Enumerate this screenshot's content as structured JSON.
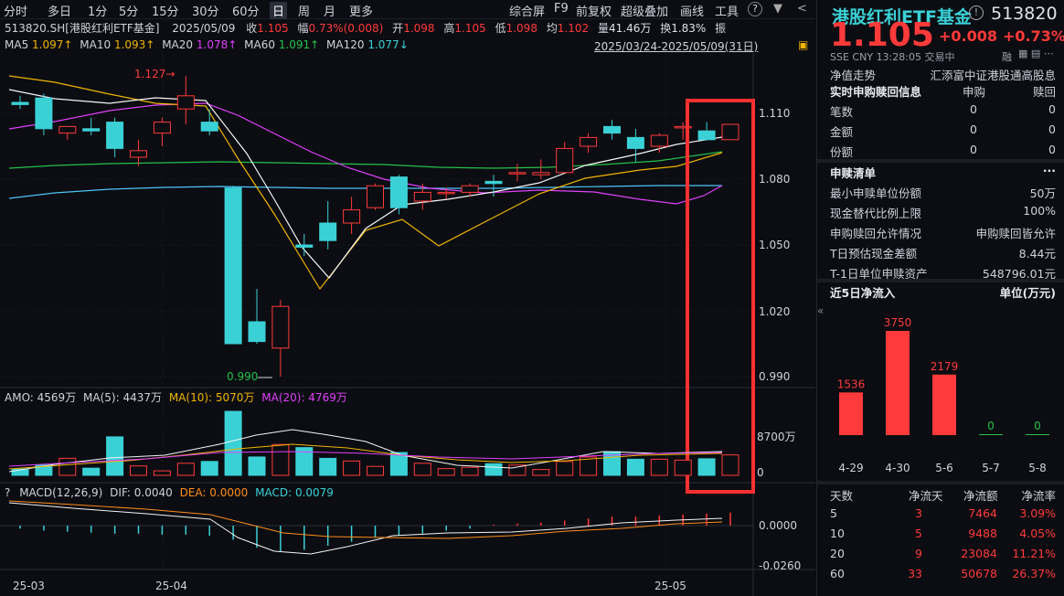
{
  "toolbar": {
    "left_items": [
      "分时",
      "多日",
      "1分",
      "5分",
      "15分",
      "30分",
      "60分",
      "日",
      "周",
      "月",
      "更多"
    ],
    "active": "日",
    "right_items": [
      "综合屏",
      "F9",
      "前复权",
      "超级叠加",
      "画线",
      "工具",
      "?"
    ]
  },
  "info": {
    "code": "513820.SH[港股红利ETF基金]",
    "date": "2025/05/09",
    "close_label": "收",
    "close": "1.105",
    "change_label": "幅",
    "change": "0.73%(0.008)",
    "open_label": "开",
    "open": "1.098",
    "high_label": "高",
    "high": "1.105",
    "low_label": "低",
    "low": "1.098",
    "avg_label": "均",
    "avg": "1.102",
    "vol_label": "量",
    "vol": "41.46万",
    "turnover_label": "换",
    "turnover": "1.83%",
    "amp_label": "振"
  },
  "ma": {
    "ma5": "MA5",
    "ma5_val": "1.097↑",
    "ma10": "MA10",
    "ma10_val": "1.093↑",
    "ma20": "MA20",
    "ma20_val": "1.078↑",
    "ma60": "MA60",
    "ma60_val": "1.091↑",
    "ma120": "MA120",
    "ma120_val": "1.077↓",
    "range": "2025/03/24-2025/05/09(31日)"
  },
  "price_axis": [
    "1.110",
    "1.080",
    "1.050",
    "1.020",
    "0.990"
  ],
  "annotations": {
    "high_mark": "1.127→",
    "low_mark": "0.990"
  },
  "amo": {
    "label": "AMO: 4569万",
    "ma5": "MA(5): 4437万",
    "ma10": "MA(10): 5070万",
    "ma20": "MA(20): 4769万",
    "axis_top": "8700万",
    "axis_zero": "0"
  },
  "macd": {
    "help": "?",
    "label": "MACD(12,26,9)",
    "dif": "DIF: 0.0040",
    "dea": "DEA: 0.0000",
    "macd": "MACD: 0.0079",
    "axis_top": "0.0000",
    "axis_bottom": "-0.0260"
  },
  "date_axis": [
    "25-03",
    "25-04",
    "25-05"
  ],
  "chart_data": {
    "type": "candlestick",
    "ohlc": [
      [
        1.115,
        1.118,
        1.112,
        1.114
      ],
      [
        1.117,
        1.119,
        1.1,
        1.103
      ],
      [
        1.101,
        1.104,
        1.098,
        1.104
      ],
      [
        1.103,
        1.108,
        1.1,
        1.102
      ],
      [
        1.106,
        1.108,
        1.09,
        1.094
      ],
      [
        1.09,
        1.098,
        1.086,
        1.093
      ],
      [
        1.101,
        1.108,
        1.095,
        1.106
      ],
      [
        1.112,
        1.127,
        1.105,
        1.118
      ],
      [
        1.106,
        1.112,
        1.1,
        1.102
      ],
      [
        1.076,
        1.077,
        1.005,
        1.005
      ],
      [
        1.015,
        1.03,
        1.005,
        1.006
      ],
      [
        1.003,
        1.025,
        0.99,
        1.022
      ],
      [
        1.05,
        1.055,
        1.045,
        1.049
      ],
      [
        1.06,
        1.07,
        1.048,
        1.052
      ],
      [
        1.06,
        1.072,
        1.055,
        1.066
      ],
      [
        1.067,
        1.078,
        1.066,
        1.077
      ],
      [
        1.081,
        1.082,
        1.064,
        1.067
      ],
      [
        1.07,
        1.078,
        1.066,
        1.074
      ],
      [
        1.074,
        1.076,
        1.071,
        1.074
      ],
      [
        1.074,
        1.078,
        1.072,
        1.077
      ],
      [
        1.079,
        1.082,
        1.072,
        1.078
      ],
      [
        1.083,
        1.087,
        1.079,
        1.083
      ],
      [
        1.082,
        1.089,
        1.08,
        1.083
      ],
      [
        1.083,
        1.097,
        1.083,
        1.094
      ],
      [
        1.095,
        1.101,
        1.092,
        1.099
      ],
      [
        1.104,
        1.107,
        1.098,
        1.101
      ],
      [
        1.099,
        1.103,
        1.088,
        1.094
      ],
      [
        1.095,
        1.101,
        1.092,
        1.1
      ],
      [
        1.104,
        1.106,
        1.098,
        1.104
      ],
      [
        1.102,
        1.106,
        1.099,
        1.098
      ],
      [
        1.098,
        1.105,
        1.098,
        1.105
      ]
    ],
    "amo": [
      1400,
      2300,
      3800,
      1600,
      8600,
      2100,
      1000,
      2700,
      3100,
      14300,
      4100,
      6900,
      6200,
      3800,
      3200,
      2000,
      5100,
      2700,
      1500,
      1800,
      2600,
      2300,
      1300,
      3100,
      4100,
      5300,
      3600,
      3600,
      3400,
      3700,
      4569
    ],
    "ylim": [
      0.985,
      1.132
    ]
  },
  "right": {
    "name": "港股红利ETF基金",
    "code": "513820",
    "price": "1.105",
    "change": "+0.008",
    "pct": "+0.73%",
    "exchange": "SSE",
    "currency": "CNY",
    "time": "13:28:05",
    "status": "交易中",
    "margin": "融",
    "netvalue_label": "净值走势",
    "index_name": "汇添富中证港股通高股息",
    "rt_title": "实时申购赎回信息",
    "rt_col1": "申购",
    "rt_col2": "赎回",
    "rt_rows": [
      [
        "笔数",
        "0",
        "0"
      ],
      [
        "金额",
        "0",
        "0"
      ],
      [
        "份额",
        "0",
        "0"
      ]
    ],
    "list_title": "申赎清单",
    "more": "···",
    "list_rows": [
      [
        "最小申赎单位份额",
        "50万"
      ],
      [
        "现金替代比例上限",
        "100%"
      ],
      [
        "申购赎回允许情况",
        "申购赎回皆允许"
      ],
      [
        "T日预估现金差额",
        "8.44元"
      ],
      [
        "T-1日单位申赎资产",
        "548796.01元"
      ]
    ],
    "flow_title": "近5日净流入",
    "flow_unit": "单位(万元)",
    "flow_bars": [
      {
        "d": "4-29",
        "v": 1536
      },
      {
        "d": "4-30",
        "v": 3750
      },
      {
        "d": "5-6",
        "v": 2179
      },
      {
        "d": "5-7",
        "v": 0
      },
      {
        "d": "5-8",
        "v": 0
      }
    ],
    "table_head": [
      "天数",
      "净流天",
      "净流额",
      "净流率"
    ],
    "table_rows": [
      [
        "5",
        "3",
        "7464",
        "3.09%"
      ],
      [
        "10",
        "5",
        "9488",
        "4.05%"
      ],
      [
        "20",
        "9",
        "23084",
        "11.21%"
      ],
      [
        "60",
        "33",
        "50678",
        "26.37%"
      ]
    ]
  }
}
